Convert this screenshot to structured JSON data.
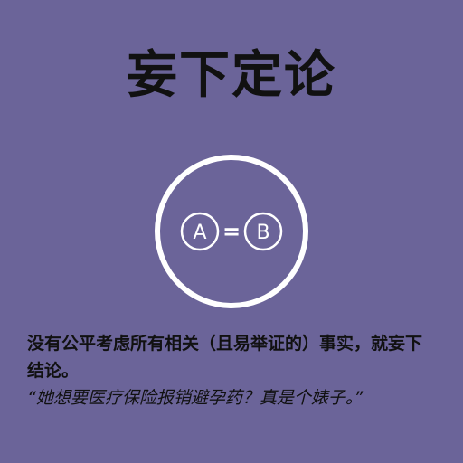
{
  "title": "妄下定论",
  "emblem": {
    "left_letter": "A",
    "equals": "=",
    "right_letter": "B",
    "icon": "a-equals-b-circle-icon",
    "ring_color": "#ffffff"
  },
  "description": "没有公平考虑所有相关（且易举证的）事实，就妄下结论。",
  "quote": "“她想要医疗保险报销避孕药？真是个婊子。”",
  "colors": {
    "background": "#6b6499",
    "text": "#111111"
  }
}
